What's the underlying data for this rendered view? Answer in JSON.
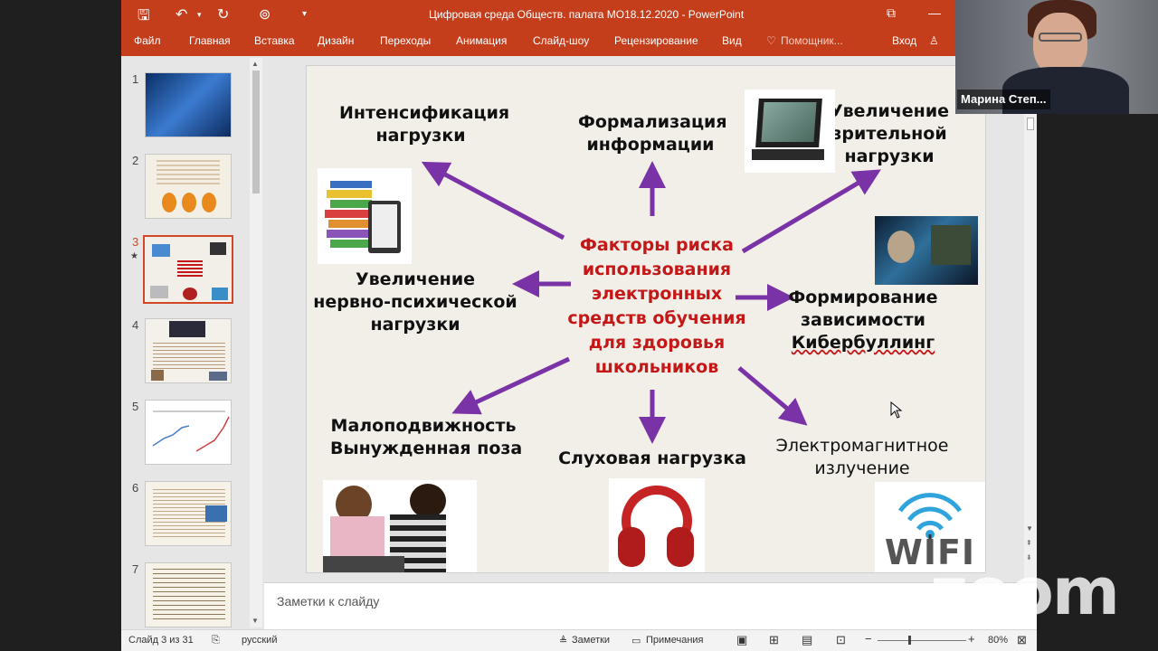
{
  "app": {
    "title": "Цифровая среда Обществ. палата МО18.12.2020 - PowerPoint",
    "tabs": [
      "Файл",
      "Главная",
      "Вставка",
      "Дизайн",
      "Переходы",
      "Анимация",
      "Слайд-шоу",
      "Рецензирование",
      "Вид"
    ],
    "tell_me": "Помощник...",
    "signin": "Вход"
  },
  "thumbnails": {
    "numbers": [
      "1",
      "2",
      "3",
      "4",
      "5",
      "6",
      "7"
    ],
    "active_index": 3
  },
  "slide": {
    "center_lines": [
      "Факторы риска",
      "использования",
      "электронных",
      "средств обучения",
      "для здоровья",
      "школьников"
    ],
    "intensification": [
      "Интенсификация",
      "нагрузки"
    ],
    "formalization": [
      "Формализация",
      "информации"
    ],
    "visual": [
      "Увеличение",
      "зрительной",
      "нагрузки"
    ],
    "neuro": [
      "Увеличение",
      "нервно-психической",
      "нагрузки"
    ],
    "dependency": [
      "Формирование",
      "зависимости",
      "Кибербуллинг"
    ],
    "hypodynamia": [
      "Малоподвижность",
      "Вынужденная  поза"
    ],
    "hearing": "Слуховая нагрузка",
    "em": [
      "Электромагнитное",
      "излучение"
    ],
    "wifi_text": "WIFI"
  },
  "notes": {
    "placeholder": "Заметки к слайду"
  },
  "status": {
    "slide_counter": "Слайд 3 из 31",
    "language": "русский",
    "notes_btn": "Заметки",
    "comments_btn": "Примечания",
    "zoom": "80%"
  },
  "video": {
    "participant": "Марина Степ..."
  },
  "zoom_watermark": "zoom",
  "colors": {
    "accent": "#c43e1c",
    "arrow": "#7a33a6",
    "center_text": "#c41818"
  }
}
